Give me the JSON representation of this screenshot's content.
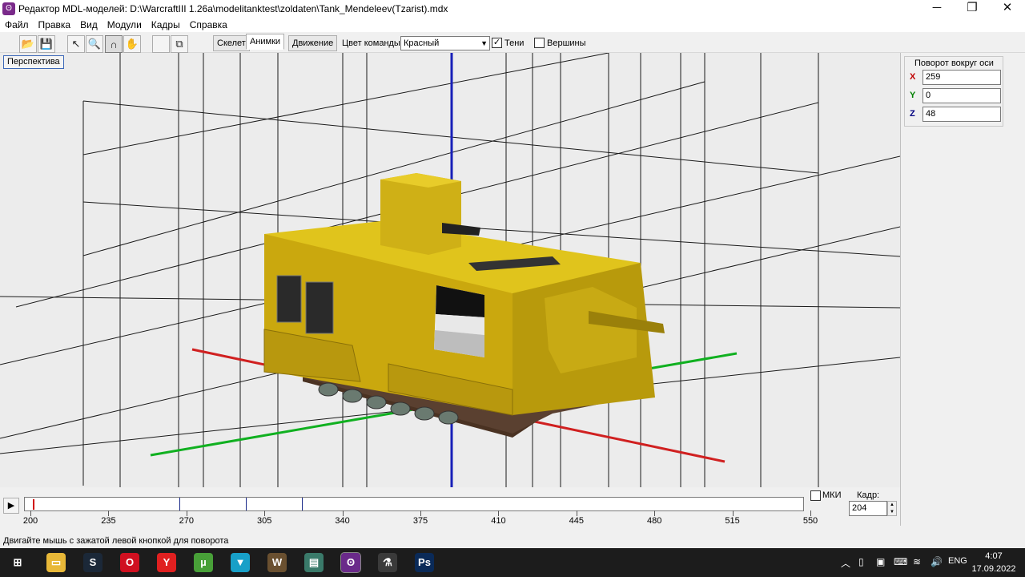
{
  "window": {
    "title": "Редактор MDL-моделей: D:\\WarcraftIII 1.26a\\modelitanktest\\zoldaten\\Tank_Mendeleev(Tzarist).mdx",
    "app_icon": "mdl-editor-icon",
    "minimize": "─",
    "maximize": "❐",
    "close": "✕"
  },
  "menu": [
    "Файл",
    "Правка",
    "Вид",
    "Модули",
    "Кадры",
    "Справка"
  ],
  "toolbar": {
    "tools": [
      {
        "name": "open-icon",
        "glyph": "📂"
      },
      {
        "name": "save-icon",
        "glyph": "💾"
      },
      {
        "name": "select-arrow-icon",
        "glyph": "↖"
      },
      {
        "name": "zoom-icon",
        "glyph": "🔍"
      },
      {
        "name": "rotate-icon",
        "glyph": "∩"
      },
      {
        "name": "pan-hand-icon",
        "glyph": "✋"
      },
      {
        "name": "blank-icon",
        "glyph": ""
      },
      {
        "name": "copy-icon",
        "glyph": "⧉"
      }
    ],
    "modes": [
      "Скелет",
      "Анимки",
      "Движение"
    ],
    "active_mode": "Анимки",
    "team_color_label": "Цвет команды:",
    "team_color_value": "Красный",
    "shadows_label": "Тени",
    "shadows_checked": true,
    "vertices_label": "Вершины",
    "vertices_checked": false
  },
  "viewport": {
    "view_button": "Перспектива",
    "model_color": "#d4b41c",
    "axes": {
      "x": "#d02020",
      "y": "#10b020",
      "z": "#1820b8"
    }
  },
  "rotation_panel": {
    "title": "Поворот вокруг оси",
    "x_label": "X",
    "x_value": "259",
    "x_color": "#c00000",
    "y_label": "Y",
    "y_value": "0",
    "y_color": "#008000",
    "z_label": "Z",
    "z_value": "48",
    "z_color": "#000080"
  },
  "timeline": {
    "play": "▶",
    "ticks": [
      "200",
      "235",
      "270",
      "305",
      "340",
      "375",
      "410",
      "445",
      "480",
      "515",
      "550"
    ],
    "mki_label": "МКИ",
    "mki_checked": false,
    "frame_label": "Кадр:",
    "frame_value": "204"
  },
  "status": "Двигайте мышь с зажатой левой кнопкой для поворота",
  "taskbar": {
    "apps": [
      {
        "name": "start-icon",
        "glyph": "⊞",
        "color": "#1c1c1c"
      },
      {
        "name": "explorer-icon",
        "glyph": "▭",
        "color": "#e8b838"
      },
      {
        "name": "steam-icon",
        "glyph": "S",
        "color": "#1b2838"
      },
      {
        "name": "opera-icon",
        "glyph": "O",
        "color": "#d01020"
      },
      {
        "name": "yandex-icon",
        "glyph": "Y",
        "color": "#e02020"
      },
      {
        "name": "utorrent-icon",
        "glyph": "µ",
        "color": "#48a038"
      },
      {
        "name": "vpn-icon",
        "glyph": "▼",
        "color": "#18a0c8"
      },
      {
        "name": "warcraft-icon",
        "glyph": "W",
        "color": "#6a5030"
      },
      {
        "name": "viewer-icon",
        "glyph": "▤",
        "color": "#3a7a6a"
      },
      {
        "name": "mdl-icon",
        "glyph": "ʘ",
        "color": "#6a2a8a"
      },
      {
        "name": "flask-icon",
        "glyph": "⚗",
        "color": "#3a3a3a"
      },
      {
        "name": "photoshop-icon",
        "glyph": "Ps",
        "color": "#0a2a58"
      }
    ],
    "tray_lang": "ENG",
    "time": "4:07",
    "date": "17.09.2022"
  }
}
